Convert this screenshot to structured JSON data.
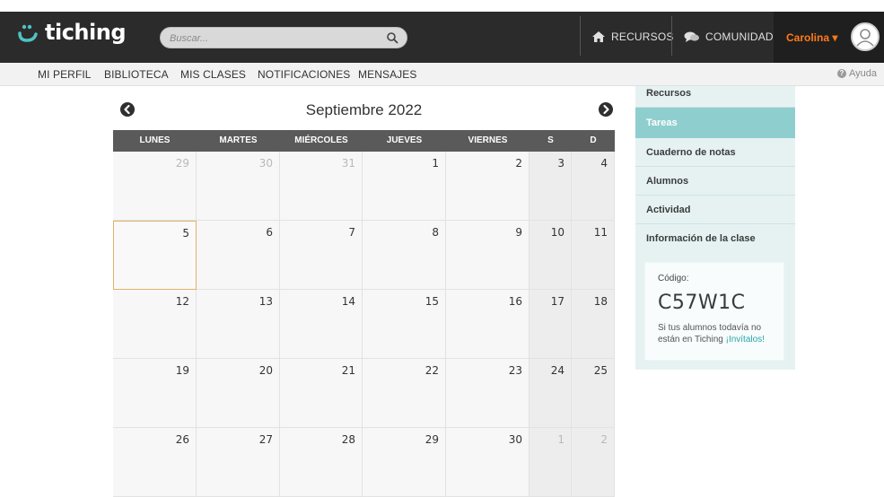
{
  "header": {
    "logo_text": "tiching",
    "search_placeholder": "Buscar...",
    "nav": [
      {
        "label": "RECURSOS",
        "icon": "home-icon"
      },
      {
        "label": "COMUNIDAD",
        "icon": "chat-icon"
      }
    ],
    "user_name": "Carolina",
    "user_caret": "▾"
  },
  "subnav": {
    "items": [
      "MI PERFIL",
      "BIBLIOTECA",
      "MIS CLASES",
      "NOTIFICACIONES",
      "MENSAJES"
    ],
    "help_label": "Ayuda",
    "help_icon": "?"
  },
  "calendar": {
    "title": "Septiembre 2022",
    "weekdays": [
      "LUNES",
      "MARTES",
      "MIÉRCOLES",
      "JUEVES",
      "VIERNES",
      "S",
      "D"
    ],
    "weeks": [
      [
        {
          "d": "29",
          "other": true
        },
        {
          "d": "30",
          "other": true
        },
        {
          "d": "31",
          "other": true
        },
        {
          "d": "1"
        },
        {
          "d": "2"
        },
        {
          "d": "3"
        },
        {
          "d": "4"
        }
      ],
      [
        {
          "d": "5",
          "today": true
        },
        {
          "d": "6"
        },
        {
          "d": "7"
        },
        {
          "d": "8"
        },
        {
          "d": "9"
        },
        {
          "d": "10"
        },
        {
          "d": "11"
        }
      ],
      [
        {
          "d": "12"
        },
        {
          "d": "13"
        },
        {
          "d": "14"
        },
        {
          "d": "15"
        },
        {
          "d": "16"
        },
        {
          "d": "17"
        },
        {
          "d": "18"
        }
      ],
      [
        {
          "d": "19"
        },
        {
          "d": "20"
        },
        {
          "d": "21"
        },
        {
          "d": "22"
        },
        {
          "d": "23"
        },
        {
          "d": "24"
        },
        {
          "d": "25"
        }
      ],
      [
        {
          "d": "26"
        },
        {
          "d": "27"
        },
        {
          "d": "28"
        },
        {
          "d": "29"
        },
        {
          "d": "30"
        },
        {
          "d": "1",
          "other": true
        },
        {
          "d": "2",
          "other": true
        }
      ]
    ]
  },
  "sidebar": {
    "items": [
      {
        "label": "Recursos"
      },
      {
        "label": "Tareas",
        "active": true
      },
      {
        "label": "Cuaderno de notas"
      },
      {
        "label": "Alumnos"
      },
      {
        "label": "Actividad"
      },
      {
        "label": "Información de la clase"
      }
    ],
    "code_label": "Código:",
    "code_value": "C57W1C",
    "code_help": "Si tus alumnos todavía no están en Tiching ",
    "code_link": "¡Invítalos!"
  },
  "colors": {
    "accent_teal": "#8fcece",
    "user_orange": "#ff7a1a",
    "topbar": "#2b2b2b"
  }
}
